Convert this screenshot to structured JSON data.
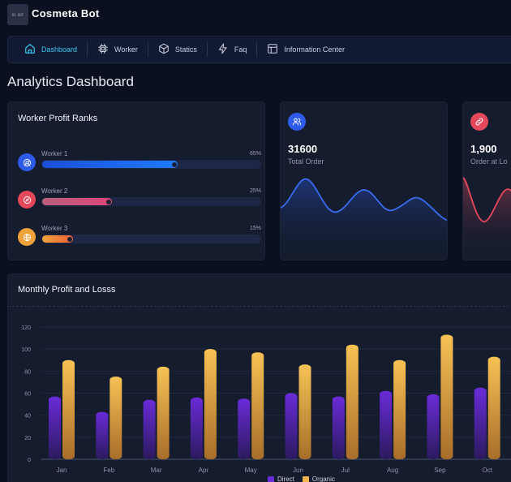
{
  "app": {
    "title": "Cosmeta Bot",
    "logo_text": "BS BOT"
  },
  "nav": [
    {
      "label": "Dashboard",
      "icon": "home-icon",
      "active": true
    },
    {
      "label": "Worker",
      "icon": "chip-icon",
      "active": false
    },
    {
      "label": "Statics",
      "icon": "cube-icon",
      "active": false
    },
    {
      "label": "Faq",
      "icon": "bolt-icon",
      "active": false
    },
    {
      "label": "Information Center",
      "icon": "layout-icon",
      "active": false
    }
  ],
  "page": {
    "title": "Analytics Dashboard"
  },
  "ranks": {
    "title": "Worker Profit Ranks",
    "items": [
      {
        "name": "Worker 1",
        "pct_label": "65%",
        "fraction": 0.62,
        "icon": "chrome-icon",
        "icon_color": "#2f5bea",
        "fill": "#1f6bff"
      },
      {
        "name": "Worker 2",
        "pct_label": "25%",
        "fraction": 0.32,
        "icon": "compass-icon",
        "icon_color": "#e5485b",
        "fill": "#d94a7a"
      },
      {
        "name": "Worker 3",
        "pct_label": "15%",
        "fraction": 0.14,
        "icon": "globe-icon",
        "icon_color": "#f0a23a",
        "fill": "#f07a3a"
      }
    ]
  },
  "stats": [
    {
      "value": "31600",
      "label": "Total Order",
      "icon": "users-icon",
      "icon_color": "#2f5bea",
      "line_color": "#3a6cf0"
    },
    {
      "value": "1,900",
      "label": "Order at Lo",
      "icon": "link-icon",
      "icon_color": "#e5485b",
      "line_color": "#e5485b"
    }
  ],
  "chart_card": {
    "title": "Monthly Profit and Losss"
  },
  "chart_data": {
    "type": "bar",
    "categories": [
      "Jan",
      "Feb",
      "Mar",
      "Apr",
      "May",
      "Jun",
      "Jul",
      "Aug",
      "Sep",
      "Oct"
    ],
    "series": [
      {
        "name": "Direct",
        "values": [
          57,
          43,
          54,
          56,
          55,
          60,
          57,
          62,
          59,
          65
        ],
        "color": "#6a2bd8"
      },
      {
        "name": "Organic",
        "values": [
          90,
          75,
          84,
          100,
          97,
          86,
          104,
          90,
          113,
          93
        ],
        "color": "#f3b54a"
      }
    ],
    "ylim": [
      0,
      120
    ],
    "yticks": [
      0,
      20,
      40,
      60,
      80,
      100,
      120
    ],
    "grid": true,
    "legend": "bottom"
  }
}
